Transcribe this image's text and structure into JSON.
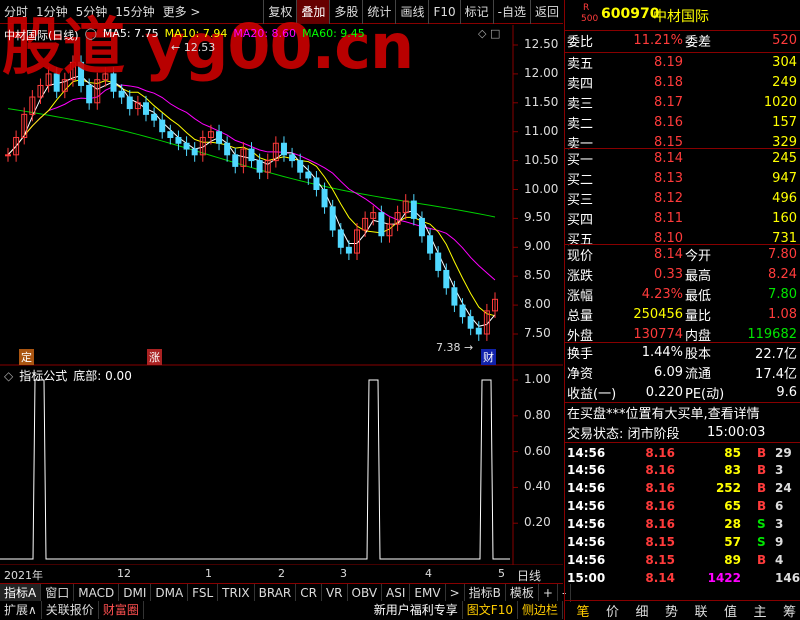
{
  "toolbar": {
    "left": [
      "分时",
      "1分钟",
      "5分钟",
      "15分钟",
      "更多 >"
    ],
    "right": [
      "复权",
      "叠加",
      "多股",
      "统计",
      "画线",
      "F10",
      "标记",
      "-自选",
      "返回"
    ]
  },
  "chart": {
    "title": "中材国际(日线)",
    "ma5": "MA5: 7.75",
    "ma10": "MA10: 7.94",
    "ma20": "MA20: 8.60",
    "ma60": "MA60: 9.45",
    "high_mark": "12.53",
    "low_mark": "7.38",
    "cai_badge": "财",
    "ding_badge": "定",
    "zhang_badge": "涨",
    "y_ticks": [
      "12.50",
      "12.00",
      "11.50",
      "11.00",
      "10.50",
      "10.00",
      "9.50",
      "9.00",
      "8.50",
      "8.00",
      "7.50"
    ],
    "sub_title": "指标公式",
    "sub_value": "底部: 0.00",
    "sub_ticks": [
      "1.00",
      "0.80",
      "0.60",
      "0.40",
      "0.20"
    ],
    "x_ticks": [
      "2021年",
      "12",
      "1",
      "2",
      "3",
      "4",
      "5"
    ],
    "x_right": "日线",
    "watermark": "股道 yg00.cn"
  },
  "bottom_tabs": [
    "指标A",
    "窗口",
    "MACD",
    "DMI",
    "DMA",
    "FSL",
    "TRIX",
    "BRAR",
    "CR",
    "VR",
    "OBV",
    "ASI",
    "EMV",
    ">",
    "指标B",
    "模板",
    "+",
    "-"
  ],
  "footer": {
    "left": [
      "扩展∧",
      "关联报价",
      "财富圈"
    ],
    "right": [
      "新用户福利专享",
      "图文F10",
      "侧边栏"
    ]
  },
  "quote": {
    "r_label": "R",
    "code_small": "500",
    "code": "600970",
    "name": "中材国际",
    "weibi_label": "委比",
    "weibi": "11.21%",
    "weicha_label": "委差",
    "weicha": "520",
    "asks": [
      {
        "label": "卖五",
        "price": "8.19",
        "vol": "304"
      },
      {
        "label": "卖四",
        "price": "8.18",
        "vol": "249"
      },
      {
        "label": "卖三",
        "price": "8.17",
        "vol": "1020"
      },
      {
        "label": "卖二",
        "price": "8.16",
        "vol": "157"
      },
      {
        "label": "卖一",
        "price": "8.15",
        "vol": "329"
      }
    ],
    "bids": [
      {
        "label": "买一",
        "price": "8.14",
        "vol": "245"
      },
      {
        "label": "买二",
        "price": "8.13",
        "vol": "947"
      },
      {
        "label": "买三",
        "price": "8.12",
        "vol": "496"
      },
      {
        "label": "买四",
        "price": "8.11",
        "vol": "160"
      },
      {
        "label": "买五",
        "price": "8.10",
        "vol": "731"
      }
    ],
    "stats": [
      {
        "l1": "现价",
        "v1": "8.14",
        "l2": "今开",
        "v2": "7.80"
      },
      {
        "l1": "涨跌",
        "v1": "0.33",
        "l2": "最高",
        "v2": "8.24"
      },
      {
        "l1": "涨幅",
        "v1": "4.23%",
        "l2": "最低",
        "v2": "7.80"
      },
      {
        "l1": "总量",
        "v1": "250456",
        "l2": "量比",
        "v2": "1.08"
      },
      {
        "l1": "外盘",
        "v1": "130774",
        "l2": "内盘",
        "v2": "119682"
      }
    ],
    "stats2": [
      {
        "l1": "换手",
        "v1": "1.44%",
        "l2": "股本",
        "v2": "22.7亿"
      },
      {
        "l1": "净资",
        "v1": "6.09",
        "l2": "流通",
        "v2": "17.4亿"
      },
      {
        "l1": "收益(一)",
        "v1": "0.220",
        "l2": "PE(动)",
        "v2": "9.6"
      }
    ],
    "notice": "在买盘***位置有大买单,查看详情",
    "status_label": "交易状态: 闭市阶段",
    "status_time": "15:00:03",
    "ticks": [
      {
        "t": "14:56",
        "p": "8.16",
        "v": "85",
        "s": "B",
        "n": "29"
      },
      {
        "t": "14:56",
        "p": "8.16",
        "v": "83",
        "s": "B",
        "n": "3"
      },
      {
        "t": "14:56",
        "p": "8.16",
        "v": "252",
        "s": "B",
        "n": "24"
      },
      {
        "t": "14:56",
        "p": "8.16",
        "v": "65",
        "s": "B",
        "n": "6"
      },
      {
        "t": "14:56",
        "p": "8.16",
        "v": "28",
        "s": "S",
        "n": "3"
      },
      {
        "t": "14:56",
        "p": "8.15",
        "v": "57",
        "s": "S",
        "n": "9"
      },
      {
        "t": "14:56",
        "p": "8.15",
        "v": "89",
        "s": "B",
        "n": "4"
      },
      {
        "t": "15:00",
        "p": "8.14",
        "v": "1422",
        "s": "",
        "n": "146"
      }
    ],
    "sidebar_tabs": [
      "笔",
      "价",
      "细",
      "势",
      "联",
      "值",
      "主",
      "筹"
    ],
    "colors": {
      "up": "#ff3b3b",
      "down": "#00e600",
      "flat": "#ffffff",
      "vol": "#ffff00",
      "accent": "#ff00ff"
    }
  }
}
